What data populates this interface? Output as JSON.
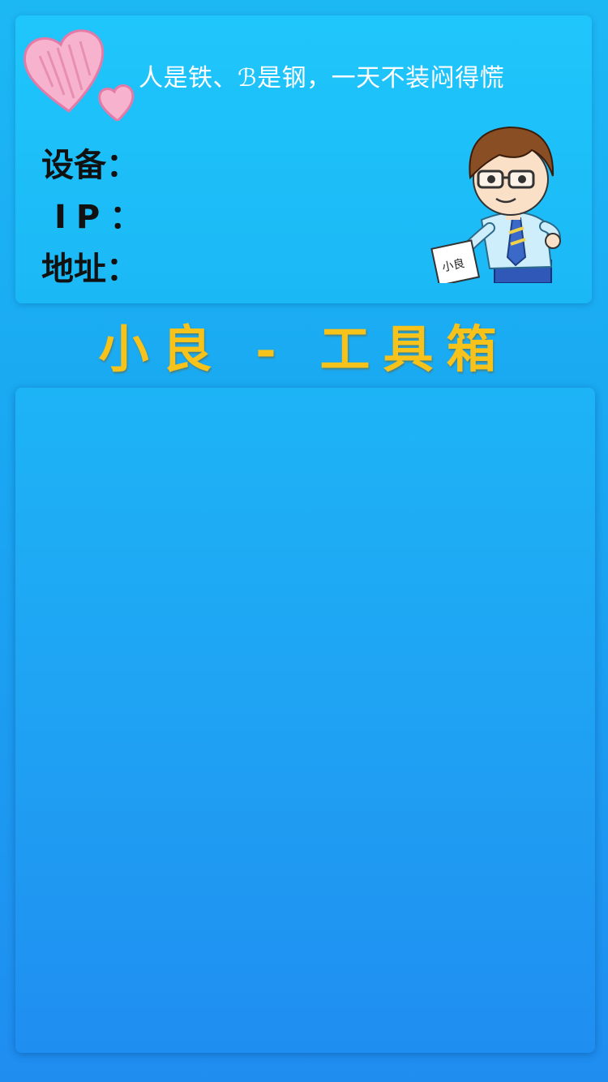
{
  "card": {
    "motto": "人是铁、ℬ是钢，一天不装闷得慌",
    "device_label": "设备：",
    "ip_label": "IP：",
    "address_label": "地址：",
    "mascot_paper_text": "小良"
  },
  "title": "小良 - 工具箱",
  "colors": {
    "background": "#1aa6f2",
    "card": "#1fc6fb",
    "title": "#f7c21a",
    "heart": "#f4a6c8"
  },
  "icons": {
    "heart": "heart-icon",
    "mascot": "mascot-image"
  }
}
